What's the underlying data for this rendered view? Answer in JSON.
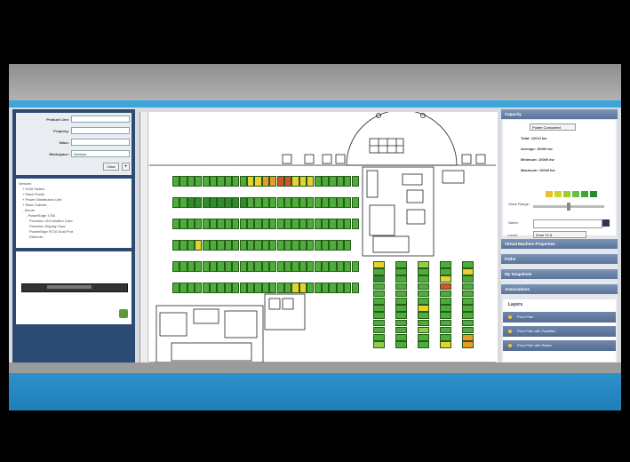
{
  "left_panel": {
    "fields": [
      {
        "label": "Product Line:",
        "value": ""
      },
      {
        "label": "Property:",
        "value": ""
      },
      {
        "label": "Value:",
        "value": ""
      },
      {
        "label": "Workspace:",
        "value": "Devices"
      }
    ],
    "clear_label": "Clear",
    "add_label": "+",
    "tree_items": [
      "Devices",
      "+ KVM Switch",
      "+ Patch Panel",
      "+ Power Distribution Unit",
      "+ Rack Cabinet",
      "- Server",
      "- PowerEdge 1750",
      "Precision 410 Modem Card",
      "Precision Display Card",
      "PowerEdge R710 Dual Port",
      "Ethernet"
    ]
  },
  "right_panel": {
    "header": "Capacity",
    "metric_select": "Power Consumed",
    "stats": [
      "Total: 12012 kw",
      "Average: 10000 kw",
      "Minimum: 10000 kw",
      "Maximum: 10000 kw"
    ],
    "range_label": "Value Range:",
    "name_label": "Name:",
    "level_label": "Level:",
    "level_value": "Zone 12 A",
    "swatch_colors": [
      "#e8c02a",
      "#cfd32c",
      "#9dcd35",
      "#6cbf3a",
      "#3ea53a",
      "#2b8a31"
    ],
    "sections": [
      "Virtual Machine Properties",
      "Paths",
      "My Snapshots",
      "Associations"
    ],
    "layers_header": "Layers",
    "layers": [
      "Floor Plan",
      "Floor Plan with Facilities",
      "Floor Plan with Racks"
    ]
  },
  "rack_colors": {
    "green": "#4cae3a",
    "dark_green": "#2f8b2c",
    "light_green": "#8fcd4a",
    "yellow": "#e7d12c",
    "orange": "#e69a2a",
    "red": "#d9502a"
  }
}
